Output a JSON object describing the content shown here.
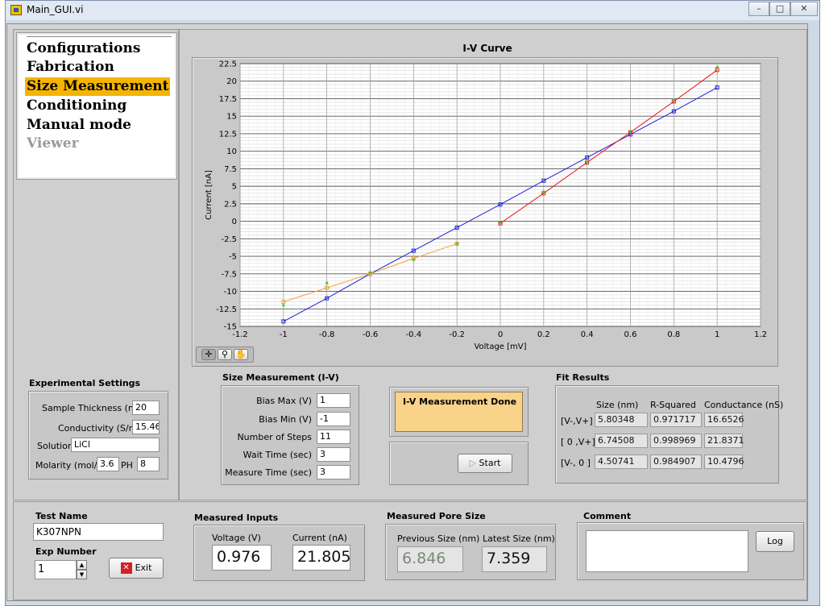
{
  "window": {
    "title": "Main_GUI.vi",
    "min": "–",
    "restore": "□",
    "close": "✕"
  },
  "menu": {
    "items": [
      {
        "label": "Configurations",
        "state": "normal"
      },
      {
        "label": "Fabrication",
        "state": "normal"
      },
      {
        "label": "Size Measurement",
        "state": "selected"
      },
      {
        "label": "Conditioning",
        "state": "normal"
      },
      {
        "label": "Manual mode",
        "state": "normal"
      },
      {
        "label": "Viewer",
        "state": "disabled"
      }
    ]
  },
  "chart_data": {
    "type": "line",
    "title": "I-V Curve",
    "xlabel": "Voltage [mV]",
    "ylabel": "Current [nA]",
    "xlim": [
      -1.2,
      1.2
    ],
    "ylim": [
      -15,
      22.5
    ],
    "xticks": [
      -1.2,
      -1,
      -0.8,
      -0.6,
      -0.4,
      -0.2,
      0,
      0.2,
      0.4,
      0.6,
      0.8,
      1,
      1.2
    ],
    "yticks": [
      22.5,
      20,
      17.5,
      15,
      12.5,
      10,
      7.5,
      5,
      2.5,
      0,
      -2.5,
      -5,
      -7.5,
      -10,
      -12.5,
      -15
    ],
    "grid": true,
    "series": [
      {
        "color": "#1f1fd6",
        "marker": "square",
        "x": [
          -1,
          -0.8,
          -0.6,
          -0.4,
          -0.2,
          0,
          0.2,
          0.4,
          0.6,
          0.8,
          1
        ],
        "y": [
          -14.3,
          -11,
          -7.5,
          -4.2,
          -0.9,
          2.4,
          5.8,
          9.1,
          12.4,
          15.7,
          19.1
        ]
      },
      {
        "color": "#e81a1a",
        "marker": "square",
        "x": [
          0,
          0.2,
          0.4,
          0.6,
          0.8,
          1
        ],
        "y": [
          -0.3,
          4,
          8.4,
          12.7,
          17.1,
          21.6
        ]
      },
      {
        "color": "#f0a030",
        "marker": "square",
        "x": [
          -1,
          -0.8,
          -0.6,
          -0.4,
          -0.2
        ],
        "y": [
          -11.5,
          -9.5,
          -7.5,
          -5.3,
          -3.2
        ]
      },
      {
        "color": "#33cc33",
        "marker": "dot",
        "x": [
          -1,
          -0.8,
          -0.6,
          -0.4,
          -0.2,
          0,
          0.2,
          0.4,
          0.6,
          0.8,
          1
        ],
        "y": [
          -12,
          -8.8,
          -7.3,
          -5.5,
          -3.2,
          -0.2,
          4.2,
          8.5,
          12.8,
          17.4,
          22
        ]
      }
    ]
  },
  "chart_tools": [
    "crosshair-tool",
    "zoom-tool",
    "pan-tool"
  ],
  "experimental": {
    "title": "Experimental Settings",
    "thickness_label": "Sample Thickness (nm)",
    "thickness": "20",
    "conductivity_label": "Conductivity (S/m)",
    "conductivity": "15.46",
    "solution_label": "Solution",
    "solution": "LiCl",
    "molarity_label": "Molarity (mol/L)",
    "molarity": "3.6",
    "ph_label": "PH",
    "ph": "8"
  },
  "size_meas": {
    "title": "Size Measurement (I-V)",
    "rows": [
      {
        "label": "Bias Max (V)",
        "value": "1"
      },
      {
        "label": "Bias Min (V)",
        "value": "-1"
      },
      {
        "label": "Number of Steps",
        "value": "11"
      },
      {
        "label": "Wait Time (sec)",
        "value": "3"
      },
      {
        "label": "Measure Time (sec)",
        "value": "3"
      }
    ]
  },
  "status": {
    "message": "I-V Measurement Done",
    "status_color": "#f9d38a",
    "start_label": "Start"
  },
  "fit": {
    "title": "Fit Results",
    "headers": [
      "Size (nm)",
      "R-Squared",
      "Conductance (nS)"
    ],
    "rows": [
      {
        "label": "[V-,V+]",
        "size": "5.80348",
        "r2": "0.971717",
        "cond": "16.6526"
      },
      {
        "label": "[ 0 ,V+]",
        "size": "6.74508",
        "r2": "0.998969",
        "cond": "21.8371"
      },
      {
        "label": "[V-, 0 ]",
        "size": "4.50741",
        "r2": "0.984907",
        "cond": "10.4796"
      }
    ]
  },
  "test": {
    "name_label": "Test Name",
    "name": "K307NPN",
    "exp_label": "Exp Number",
    "exp": "1",
    "exit_label": "Exit"
  },
  "measured_inputs": {
    "title": "Measured Inputs",
    "voltage_label": "Voltage (V)",
    "voltage": "0.976",
    "current_label": "Current (nA)",
    "current": "21.805"
  },
  "pore": {
    "title": "Measured Pore Size",
    "prev_label": "Previous Size (nm)",
    "prev": "6.846",
    "latest_label": "Latest Size (nm)",
    "latest": "7.359"
  },
  "comment": {
    "title": "Comment",
    "value": "",
    "log_label": "Log"
  }
}
